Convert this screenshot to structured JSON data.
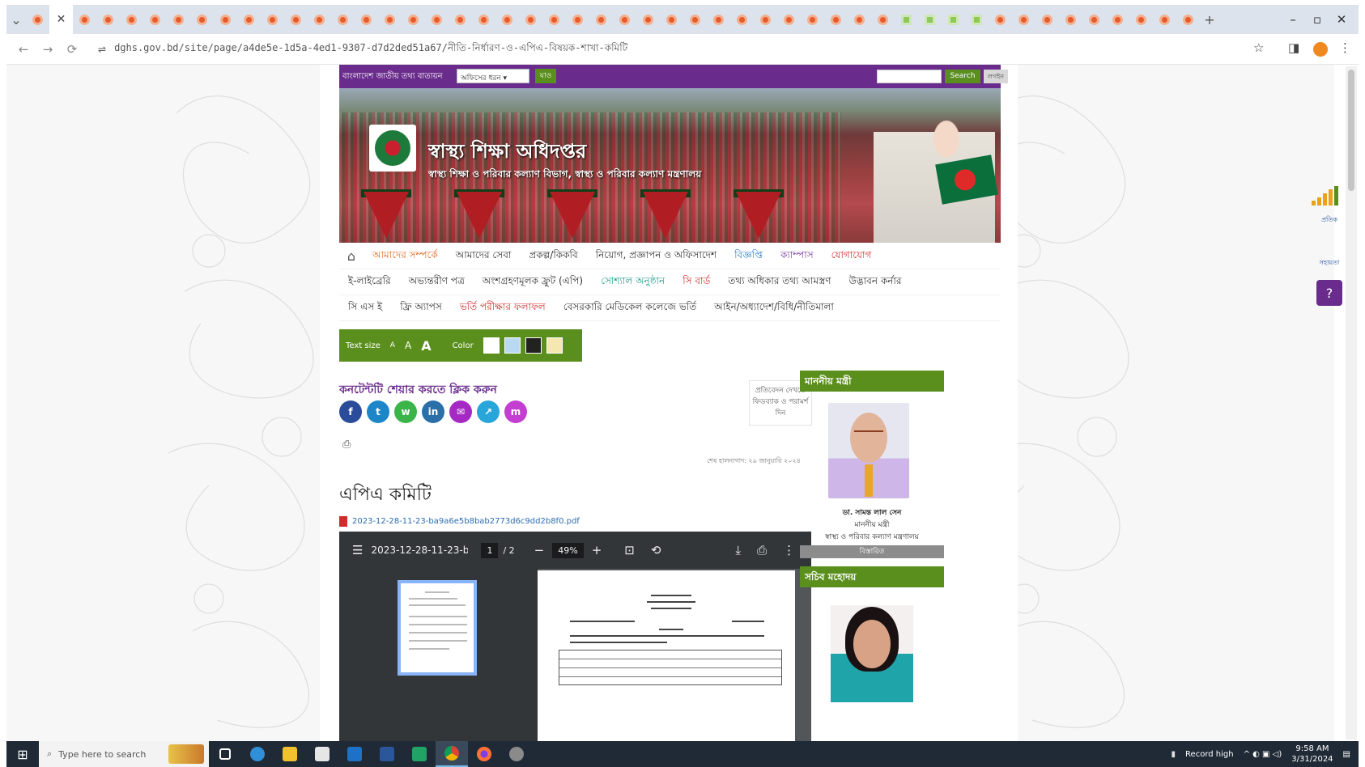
{
  "browser": {
    "new_tab_symbol": "+",
    "window_controls": [
      "–",
      "▫",
      "✕"
    ],
    "url": "dghs.gov.bd/site/page/a4de5e-1d5a-4ed1-9307-d7d2ded51a67/নীতি-নির্ধারণ-ও-এপিএ-বিষয়ক-শাখা-কমিটি",
    "favicon_count": 50,
    "green_favicons": [
      37,
      38,
      39,
      40
    ],
    "icons": {
      "back": "←",
      "forward": "→",
      "reload": "⟳",
      "site_info": "⇌",
      "bookmark": "☆",
      "side_panel": "◨",
      "menu": "⋮"
    }
  },
  "site": {
    "topbar": {
      "label": "বাংলাদেশ জাতীয় তথ্য বাতায়ন",
      "select_value": "অফিসের ধরন",
      "go_label": "যাও",
      "search_label": "Search",
      "login_label": "লগইন"
    },
    "banner": {
      "title": "স্বাস্থ্য শিক্ষা অধিদপ্তর",
      "subtitle": "স্বাস্থ্য শিক্ষা ও পরিবার কল্যাণ বিভাগ, স্বাস্থ্য ও পরিবার কল্যাণ মন্ত্রণালয়"
    },
    "menu": {
      "home_icon": "⌂",
      "row1": [
        {
          "label": "আমাদের সম্পর্কে",
          "color": "orange"
        },
        {
          "label": "আমাদের সেবা",
          "color": ""
        },
        {
          "label": "প্রকল্প/কিকবি",
          "color": ""
        },
        {
          "label": "নিয়োগ, প্রজ্ঞাপন ও অফিসাদেশ",
          "color": ""
        },
        {
          "label": "বিজ্ঞপ্তি",
          "color": "blue"
        },
        {
          "label": "ক্যাম্পাস",
          "color": "purple"
        },
        {
          "label": "যোগাযোগ",
          "color": "red"
        }
      ],
      "row2": [
        {
          "label": "ই-লাইব্রেরি",
          "color": ""
        },
        {
          "label": "অভ্যন্তরীণ পত্র",
          "color": ""
        },
        {
          "label": "অংশগ্রহণমূলক ফ্রুট (এপি)",
          "color": ""
        },
        {
          "label": "সোশ্যাল অনুষ্ঠান",
          "color": "teal"
        },
        {
          "label": "সি বার্ড",
          "color": "red"
        },
        {
          "label": "তথ্য অধিকার তথ্য আমস্ত্রণ",
          "color": ""
        },
        {
          "label": "উদ্ভাবন কর্নার",
          "color": ""
        }
      ],
      "row3": [
        {
          "label": "সি এস ই",
          "color": ""
        },
        {
          "label": "ফ্রি অ্যাপস",
          "color": ""
        },
        {
          "label": "ভর্তি পরীক্ষার ফলাফল",
          "color": "red"
        },
        {
          "label": "বেসরকারি মেডিকেল কলেজে ভর্তি",
          "color": ""
        },
        {
          "label": "আইন/অধ্যাদেশ/বিধি/নীতিমালা",
          "color": ""
        }
      ]
    },
    "accessibility": {
      "text_size_label": "Text size",
      "small": "A",
      "medium": "A",
      "large": "A",
      "color_label": "Color",
      "swatches": [
        "#ffffff",
        "#b9d9f2",
        "#222222",
        "#f5e7b0"
      ]
    },
    "share": {
      "heading": "কনটেন্টটি শেয়ার করতে ক্লিক করুন",
      "icons": [
        {
          "name": "facebook-icon",
          "glyph": "f",
          "color": "#2b4c9a"
        },
        {
          "name": "twitter-icon",
          "glyph": "t",
          "color": "#1d86c9"
        },
        {
          "name": "whatsapp-icon",
          "glyph": "w",
          "color": "#3bb54a"
        },
        {
          "name": "linkedin-icon",
          "glyph": "in",
          "color": "#2a6fa8"
        },
        {
          "name": "email-icon",
          "glyph": "✉",
          "color": "#a52ac4"
        },
        {
          "name": "share-link-icon",
          "glyph": "↗",
          "color": "#28a6d9"
        },
        {
          "name": "messenger-icon",
          "glyph": "m",
          "color": "#c33ed1"
        }
      ],
      "print_icon": "⎙"
    },
    "feedback": "প্রতিবেদন দেখতে ফিডব্যাক ও পরামর্শ দিন",
    "update_text": "শেষ হালনাগাদ: ২৯ জানুয়ারি ২০২৪",
    "page_heading": "এপিএ কমিটি",
    "pdf_link": "2023-12-28-11-23-ba9a6e5b8bab2773d6c9dd2b8f0.pdf",
    "pdf_viewer": {
      "title": "2023-12-28-11-23-b...",
      "page_current": "1",
      "page_total": "/ 2",
      "zoom": "49%",
      "icons": {
        "menu": "☰",
        "zoom_out": "−",
        "zoom_in": "+",
        "fit": "⊡",
        "rotate": "⟲",
        "download": "⤓",
        "print": "⎙",
        "more": "⋮"
      }
    },
    "sidebar": {
      "minister_heading": "মাননীয় মন্ত্রী",
      "minister_name": "ডা. সামন্ত লাল সেন",
      "minister_role": "মাননীয় মন্ত্রী",
      "minister_ministry": "স্বাস্থ্য ও পরিবার কল্যাণ মন্ত্রণালয়",
      "minister_button": "বিস্তারিত",
      "secretary_heading": "সচিব মহোদয়"
    },
    "right_widget": {
      "label1": "প্রতিক",
      "label2": "সহায়তা",
      "help_icon": "?"
    }
  },
  "taskbar": {
    "search_placeholder": "Type here to search",
    "start_icon": "⊞",
    "search_icon": "⌕",
    "weather": "Record high",
    "time": "9:58 AM",
    "date": "3/31/2024"
  }
}
